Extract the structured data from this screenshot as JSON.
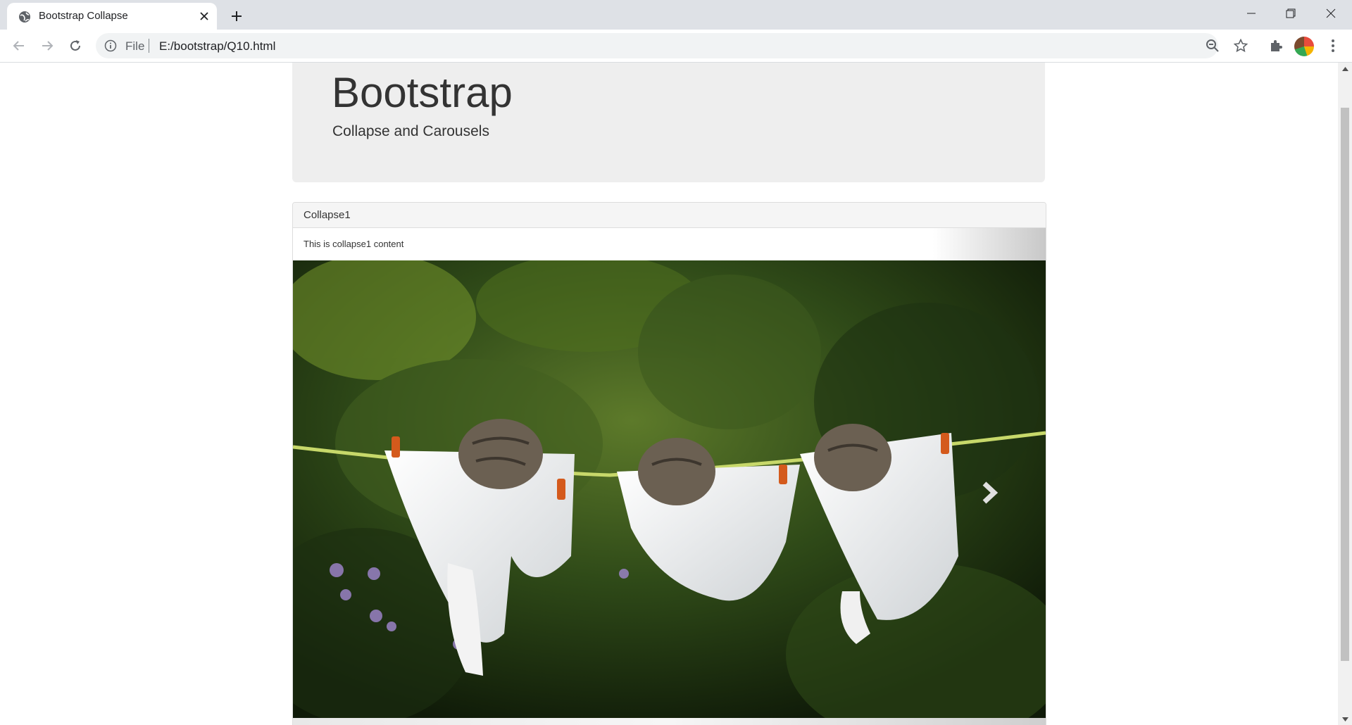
{
  "browser": {
    "tab_title": "Bootstrap Collapse",
    "url_scheme": "File",
    "url": "E:/bootstrap/Q10.html"
  },
  "page": {
    "jumbotron": {
      "title": "Bootstrap",
      "subtitle": "Collapse and Carousels"
    },
    "panel": {
      "heading": "Collapse1",
      "body": "This is collapse1 content"
    }
  },
  "colors": {
    "tabbar": "#dee1e6",
    "jumbotron_bg": "#eeeeee",
    "panel_heading_bg": "#f5f5f5",
    "text": "#333333"
  },
  "icons": {
    "tab": [
      "globe-icon",
      "close-icon",
      "plus-icon"
    ],
    "window": [
      "minimize-icon",
      "restore-icon",
      "close-window-icon"
    ],
    "toolbar": [
      "back-icon",
      "forward-icon",
      "reload-icon",
      "info-icon",
      "zoom-icon",
      "star-icon",
      "extensions-icon",
      "menu-icon"
    ],
    "carousel": [
      "chevron-right-icon"
    ]
  }
}
